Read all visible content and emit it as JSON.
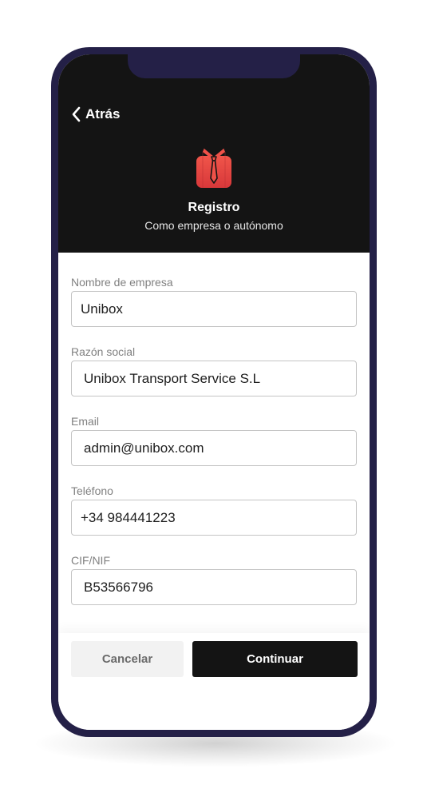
{
  "header": {
    "back_label": "Atrás",
    "title": "Registro",
    "subtitle": "Como empresa o autónomo",
    "logo_icon": "shirt-tie-icon",
    "logo_color": "#e8453c"
  },
  "form": {
    "fields": [
      {
        "label": "Nombre de empresa",
        "value": "Unibox"
      },
      {
        "label": "Razón social",
        "value": "Unibox Transport Service S.L"
      },
      {
        "label": "Email",
        "value": "admin@unibox.com"
      },
      {
        "label": "Teléfono",
        "value": "+34 984441223"
      },
      {
        "label": "CIF/NIF",
        "value": "B53566796"
      }
    ]
  },
  "actions": {
    "cancel_label": "Cancelar",
    "continue_label": "Continuar"
  },
  "colors": {
    "header_bg": "#141414",
    "phone_frame": "#242047",
    "primary_button": "#141414",
    "secondary_button": "#f2f2f2"
  }
}
